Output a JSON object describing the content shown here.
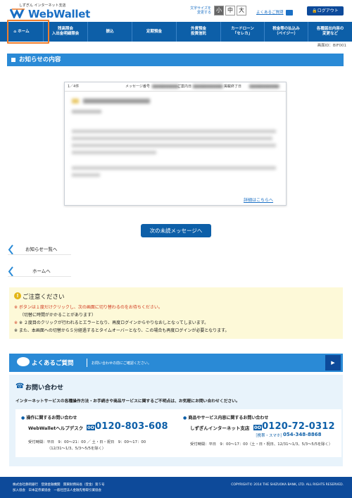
{
  "header": {
    "brand_small": "しずぎん インターネット支店",
    "brand_main": "WebWallet",
    "font_size_label": "文字サイズを変更する",
    "font_sizes": [
      "小",
      "中",
      "大"
    ],
    "help_link": "よくあるご質問",
    "logout": "ログアウト"
  },
  "nav": {
    "items": [
      {
        "label": "ホーム"
      },
      {
        "label": "残高照会\n入出金明細照会"
      },
      {
        "label": "振込"
      },
      {
        "label": "定期預金"
      },
      {
        "label": "外貨預金\n投資信託"
      },
      {
        "label": "カードローン\n「セレカ」"
      },
      {
        "label": "税金等の払込み\n（ペイジー）"
      },
      {
        "label": "各種届出内容の\n変更など"
      }
    ]
  },
  "screen_id": "画面ID：BIF001",
  "page_title": "お知らせの内容",
  "message": {
    "count": "1／4件",
    "number_label": "メッセージ番号",
    "date_label": "ご案内日",
    "end_label": "掲載終了日",
    "detail_link": "詳細はこちらへ"
  },
  "buttons": {
    "next": "次の未読メッセージへ",
    "back_list": "お知らせ一覧へ",
    "back_home": "ホームへ"
  },
  "caution": {
    "title": "ご注意ください",
    "lines": [
      "※ ボタンは１度だけクリックし、次の画面に切り替わるのをお待ちください。",
      "（切替に時間がかかることがあります）",
      "※ ２度目のクリックが行われるとエラーとなり、再度ログインからやりなおしとなってしまいます。",
      "※ また、本画面への切替から５分経過するとタイムオーバーとなり、この場合も再度ログインが必要となります。"
    ]
  },
  "faq": {
    "title": "よくあるご質問",
    "subtitle": "お問い合わせの前にご確認ください。"
  },
  "contact": {
    "title": "お問い合わせ",
    "text": "インターネットサービスの各種操作方法・お手続きや商品サービスに関するご不明点は、お気軽にお問い合わせください。",
    "left": {
      "title": "操作に関するお問い合わせ",
      "name": "WebWalletヘルプデスク",
      "phone": "0120-803-608",
      "hours": "受付時間：平日　9：00〜21：00 ／ 土・日・祝日　9：00〜17：00",
      "hours2": "（12/31〜1/3、5/3〜5/5を除く）"
    },
    "right": {
      "title": "商品やサービス内容に関するお問い合わせ",
      "name": "しずぎんインターネット支店",
      "phone": "0120-72-0312",
      "mobile_label": "［携帯・スマホ］",
      "mobile": "054-348-8868",
      "hours": "受付時間：平日　9：00〜17：00（土・日・祝日、12/31〜1/3、5/3〜5/5を除く）"
    }
  },
  "footer": {
    "line1": "株式会社静岡銀行　登録金融機関　関東財務局長（登金）第５号",
    "line2": "加入協会　日本証券業協会　一般社団法人金融先物取引業協会",
    "copyright": "COPYRIGHT© 2014 THE SHIZUOKA BANK, LTD. ALL RIGHTS RESERVED."
  }
}
